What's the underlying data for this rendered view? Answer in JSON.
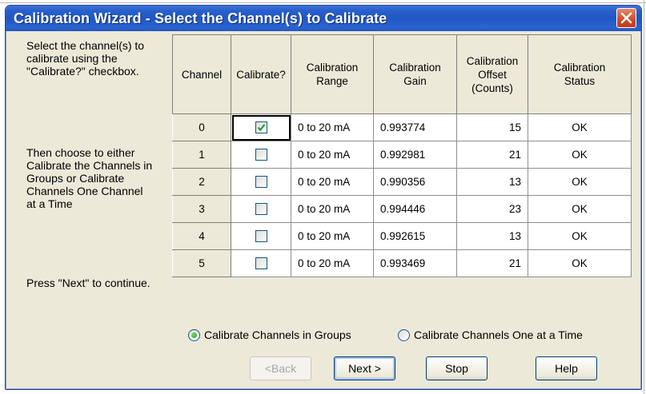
{
  "window": {
    "title": "Calibration Wizard - Select the Channel(s) to Calibrate"
  },
  "instructions": {
    "select": "Select the channel(s) to\ncalibrate using the\n\"Calibrate?\" checkbox.",
    "choose": "Then choose to either\nCalibrate the Channels in\nGroups or Calibrate\nChannels One Channel\nat a Time",
    "press_next": "Press \"Next\" to continue."
  },
  "grid": {
    "headers": [
      "Channel",
      "Calibrate?",
      "Calibration\nRange",
      "Calibration\nGain",
      "Calibration\nOffset\n(Counts)",
      "Calibration\nStatus"
    ],
    "rows": [
      {
        "channel": "0",
        "calibrate": true,
        "range": "0 to 20 mA",
        "gain": "0.993774",
        "offset": "15",
        "status": "OK"
      },
      {
        "channel": "1",
        "calibrate": false,
        "range": "0 to 20 mA",
        "gain": "0.992981",
        "offset": "21",
        "status": "OK"
      },
      {
        "channel": "2",
        "calibrate": false,
        "range": "0 to 20 mA",
        "gain": "0.990356",
        "offset": "13",
        "status": "OK"
      },
      {
        "channel": "3",
        "calibrate": false,
        "range": "0 to 20 mA",
        "gain": "0.994446",
        "offset": "23",
        "status": "OK"
      },
      {
        "channel": "4",
        "calibrate": false,
        "range": "0 to 20 mA",
        "gain": "0.992615",
        "offset": "13",
        "status": "OK"
      },
      {
        "channel": "5",
        "calibrate": false,
        "range": "0 to 20 mA",
        "gain": "0.993469",
        "offset": "21",
        "status": "OK"
      }
    ]
  },
  "options": {
    "groups_label": "Calibrate Channels in Groups",
    "one_at_a_time_label": "Calibrate Channels One at a Time",
    "selected": "groups"
  },
  "buttons": {
    "back": "<Back",
    "next": "Next >",
    "stop": "Stop",
    "help": "Help"
  },
  "colors": {
    "titlebar": "#2457c2",
    "dialog_face": "#ece9d8",
    "close_button": "#d2492a",
    "check_mark": "#21a121"
  }
}
